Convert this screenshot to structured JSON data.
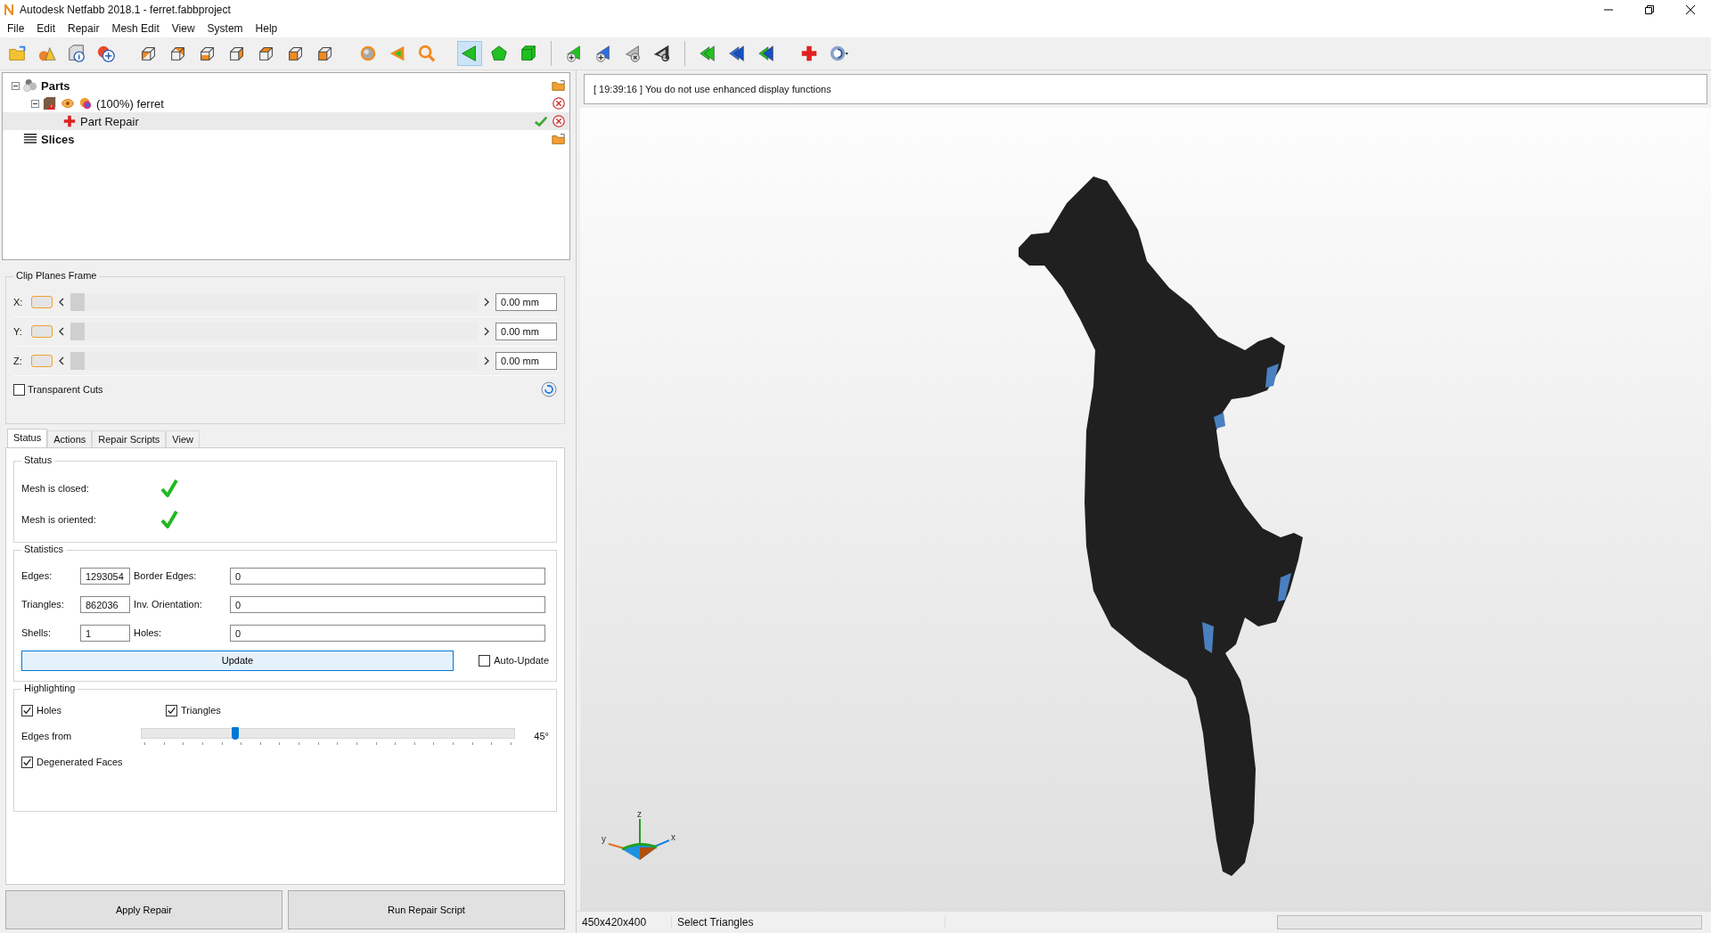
{
  "window": {
    "title": "Autodesk Netfabb 2018.1 - ferret.fabbproject"
  },
  "menu": [
    "File",
    "Edit",
    "Repair",
    "Mesh Edit",
    "View",
    "System",
    "Help"
  ],
  "toolbar": [
    {
      "kind": "open",
      "selected": false
    },
    {
      "kind": "shapes",
      "selected": false
    },
    {
      "kind": "info",
      "selected": false
    },
    {
      "kind": "add-part",
      "selected": false
    },
    {
      "kind": "view-front",
      "selected": false
    },
    {
      "kind": "view-back",
      "selected": false
    },
    {
      "kind": "view-left",
      "selected": false
    },
    {
      "kind": "view-right",
      "selected": false
    },
    {
      "kind": "view-top",
      "selected": false
    },
    {
      "kind": "view-bottom",
      "selected": false
    },
    {
      "kind": "view-iso",
      "selected": false
    },
    {
      "kind": "sphere",
      "selected": false
    },
    {
      "kind": "arrow",
      "selected": false
    },
    {
      "kind": "zoom",
      "selected": false
    },
    {
      "kind": "select-triangle",
      "selected": true
    },
    {
      "kind": "select-surface",
      "selected": false
    },
    {
      "kind": "select-shell",
      "selected": false
    },
    {
      "kind": "add-triangle",
      "selected": false
    },
    {
      "kind": "add-vertex",
      "selected": false
    },
    {
      "kind": "remove-triangle",
      "selected": false
    },
    {
      "kind": "undo-triangle",
      "selected": false
    },
    {
      "kind": "flip-green",
      "selected": false
    },
    {
      "kind": "flip-blue",
      "selected": false
    },
    {
      "kind": "flip-mixed",
      "selected": false
    },
    {
      "kind": "repair",
      "selected": false
    },
    {
      "kind": "view-menu",
      "selected": false
    }
  ],
  "tree": [
    {
      "label": "Parts",
      "kind": "parts",
      "expanded": true,
      "selected": false,
      "children": [
        {
          "label": "(100%) ferret",
          "kind": "part",
          "expanded": true,
          "selected": false,
          "children": [
            {
              "label": "Part Repair",
              "kind": "repair",
              "selected": true
            }
          ]
        }
      ]
    },
    {
      "label": "Slices",
      "kind": "slices",
      "selected": false
    }
  ],
  "clip_planes": {
    "title": "Clip Planes Frame",
    "axes": [
      {
        "label": "X:",
        "on": false,
        "level": 0,
        "value": "0.00 mm"
      },
      {
        "label": "Y:",
        "on": false,
        "level": 0,
        "value": "0.00 mm"
      },
      {
        "label": "Z:",
        "on": false,
        "level": 0,
        "value": "0.00 mm"
      }
    ],
    "transparent_cuts": {
      "label": "Transparent Cuts",
      "checked": false
    }
  },
  "tabs": [
    {
      "label": "Status",
      "selected": true
    },
    {
      "label": "Actions",
      "selected": false
    },
    {
      "label": "Repair Scripts",
      "selected": false
    },
    {
      "label": "View",
      "selected": false
    }
  ],
  "status": {
    "title": "Status",
    "items": [
      {
        "label": "Mesh is closed:",
        "ok": true
      },
      {
        "label": "Mesh is oriented:",
        "ok": true
      }
    ]
  },
  "statistics": {
    "title": "Statistics",
    "rows": [
      {
        "label": "Edges:",
        "value": "1293054",
        "label2": "Border Edges:",
        "value2": "0"
      },
      {
        "label": "Triangles:",
        "value": "862036",
        "label2": "Inv. Orientation:",
        "value2": "0"
      },
      {
        "label": "Shells:",
        "value": "1",
        "label2": "Holes:",
        "value2": "0"
      }
    ],
    "update_button": "Update",
    "auto_update": {
      "label": "Auto-Update",
      "checked": false
    }
  },
  "highlighting": {
    "title": "Highlighting",
    "holes": {
      "label": "Holes",
      "checked": true
    },
    "triangles": {
      "label": "Triangles",
      "checked": true
    },
    "edges_from": {
      "label": "Edges from",
      "level": 0.25,
      "reading": "45°"
    },
    "degenerated_faces": {
      "label": "Degenerated Faces",
      "checked": true
    }
  },
  "buttons": [
    "Apply Repair",
    "Run Repair Script"
  ],
  "log": [
    "[ 19:39:16 ] You do not use enhanced display functions"
  ],
  "axis_gizmo": {
    "labels": [
      "z",
      "y",
      "x"
    ]
  },
  "status_bar": {
    "size": "450x420x400",
    "mode": "Select Triangles",
    "progress": {
      "level": 0
    }
  }
}
